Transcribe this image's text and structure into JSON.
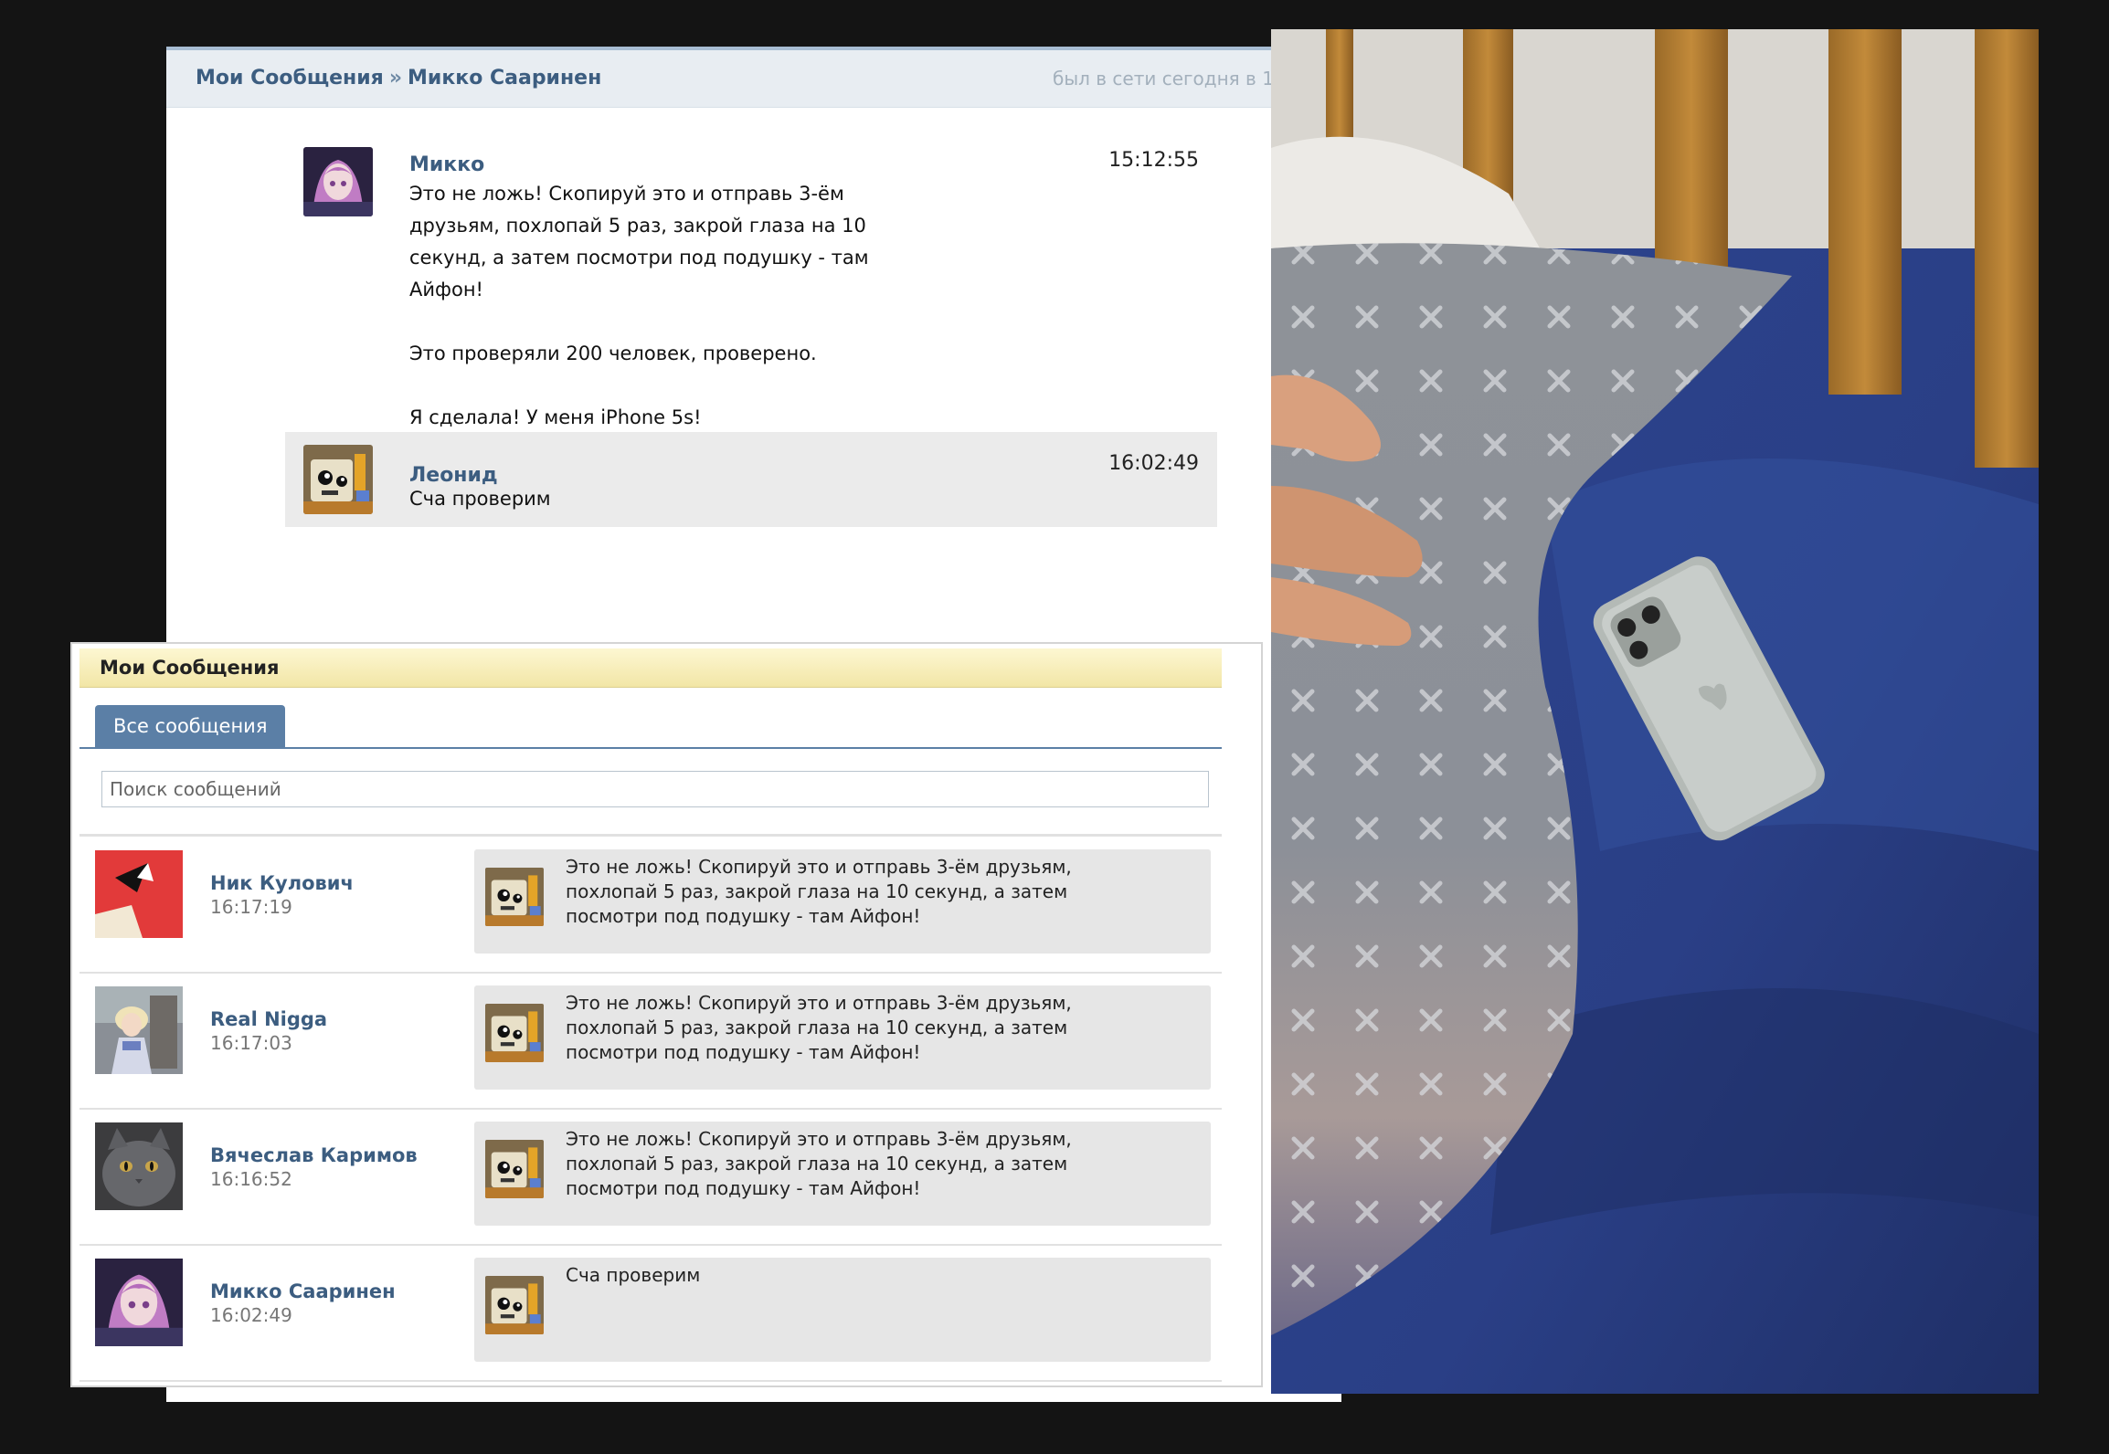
{
  "chat": {
    "breadcrumb_root": "Мои Сообщения",
    "breadcrumb_sep": "»",
    "breadcrumb_name": "Микко Сааринен",
    "status": "был в сети сегодня в 1",
    "messages": [
      {
        "author": "Микко",
        "time": "15:12:55",
        "lines": [
          "Это не ложь! Скопируй это и отправь 3-ём друзьям, похлопай 5 раз, закрой глаза на 10 секунд, а затем посмотри под подушку - там Айфон!",
          "Это проверяли 200 человек, проверено.",
          "Я сделала! У меня iPhone 5s!"
        ]
      },
      {
        "author": "Леонид",
        "time": "16:02:49",
        "lines": [
          "Сча проверим"
        ]
      }
    ]
  },
  "dialogs": {
    "title": "Мои Сообщения",
    "tab_label": "Все сообщения",
    "search_placeholder": "Поиск сообщений",
    "rows": [
      {
        "name": "Ник Кулович",
        "time": "16:17:19",
        "preview": "Это не ложь! Скопируй это и отправь 3-ём друзьям, похлопай 5 раз, закрой глаза на 10 секунд, а затем посмотри под подушку - там Айфон!"
      },
      {
        "name": "Real Nigga",
        "time": "16:17:03",
        "preview": "Это не ложь! Скопируй это и отправь 3-ём друзьям, похлопай 5 раз, закрой глаза на 10 секунд, а затем посмотри под подушку - там Айфон!"
      },
      {
        "name": "Вячеслав Каримов",
        "time": "16:16:52",
        "preview": "Это не ложь! Скопируй это и отправь 3-ём друзьям, похлопай 5 раз, закрой глаза на 10 секунд, а затем посмотри под подушку - там Айфон!"
      },
      {
        "name": "Микко Сааринен",
        "time": "16:02:49",
        "preview": "Сча проверим"
      }
    ]
  },
  "colors": {
    "link_blue": "#3c5d80",
    "tab_blue": "#5b7fa6",
    "header_yellow": "#f2e6a6",
    "bubble_gray": "#e6e6e6"
  },
  "icons": {
    "avatar_mikko": "anime-girl-avatar",
    "avatar_leonid": "cartoon-robot-avatar",
    "avatar_nik": "red-abstract-avatar",
    "avatar_real": "anime-figure-avatar",
    "avatar_vyacheslav": "gray-cat-avatar"
  }
}
